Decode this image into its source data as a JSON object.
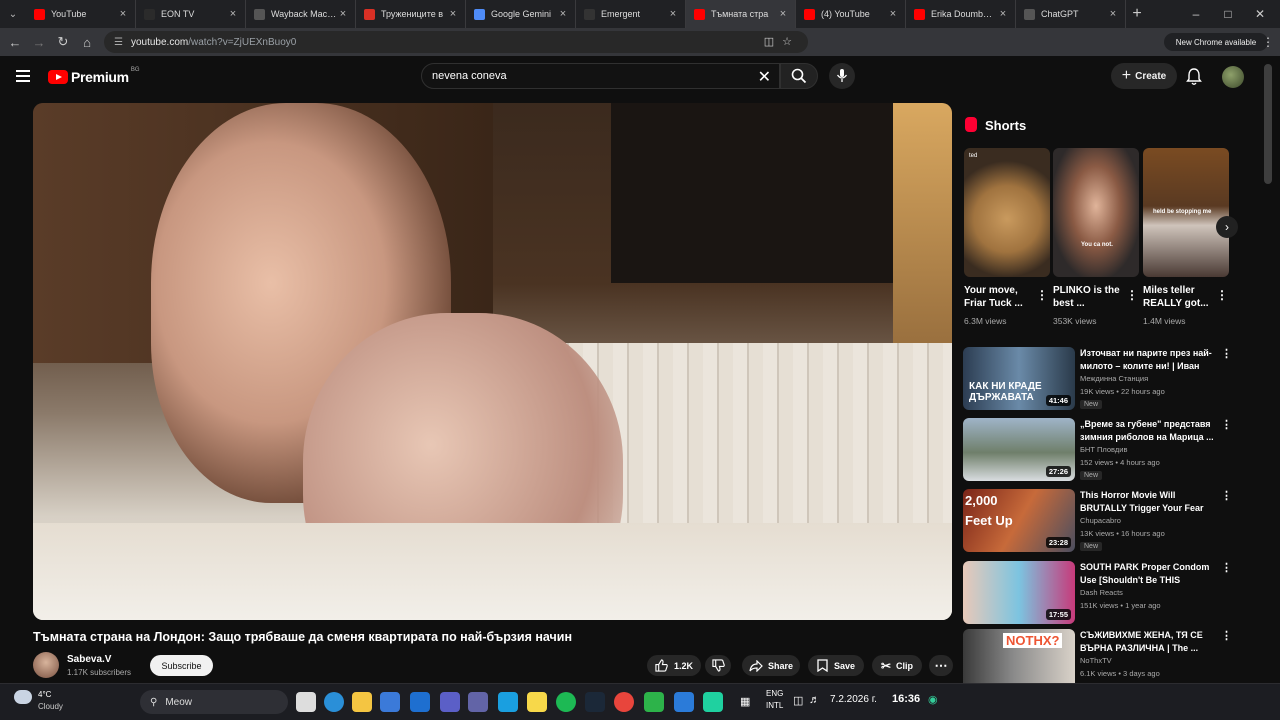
{
  "tabs": [
    {
      "title": "YouTube",
      "color": "#ff0000"
    },
    {
      "title": "EON TV",
      "color": "#2b2b2b"
    },
    {
      "title": "Wayback Machine",
      "color": "#555555"
    },
    {
      "title": "Тружениците в",
      "color": "#d93025"
    },
    {
      "title": "Google Gemini",
      "color": "#4f8cf7"
    },
    {
      "title": "Emergent",
      "color": "#333333"
    },
    {
      "title": "Тъмната стра",
      "color": "#ff0000"
    },
    {
      "title": "(4) YouTube",
      "color": "#ff0000"
    },
    {
      "title": "Erika Doumbova",
      "color": "#ff0000"
    },
    {
      "title": "ChatGPT",
      "color": "#555555"
    }
  ],
  "address": {
    "host": "youtube.com",
    "path": "/watch?v=ZjUEXnBuoy0"
  },
  "chrome_badge": "New Chrome available",
  "yt": {
    "logo": "Premium",
    "region": "BG",
    "search_value": "nevena coneva",
    "create_label": "Create"
  },
  "video": {
    "title": "Тъмната страна на Лондон: Защо трябваше да сменя квартирата по най-бързия начин",
    "channel": "Sabeva.V",
    "subscribers": "1.17K subscribers",
    "subscribe_label": "Subscribe",
    "likes": "1.2K",
    "share_label": "Share",
    "save_label": "Save",
    "clip_label": "Clip"
  },
  "shorts": {
    "heading": "Shorts",
    "items": [
      {
        "title": "Your move, Friar Tuck ...",
        "views": "6.3M views",
        "overlay": "ted"
      },
      {
        "title": "PLINKO is the best ...",
        "views": "353K views",
        "overlay": "You ca not."
      },
      {
        "title": "Miles teller REALLY got...",
        "views": "1.4M views",
        "overlay": "held be stopping me"
      }
    ]
  },
  "recommended": [
    {
      "title": "Източват ни парите през най-милото – колите ни! | Иван и...",
      "channel": "Междинна Станция",
      "meta": "19K views • 22 hours ago",
      "new": "New",
      "duration": "41:46",
      "thumb_text": "КАК НИ КРАДЕ ДЪРЖАВАТА"
    },
    {
      "title": "„Време за губене\" представя зимния риболов на Марица ...",
      "channel": "БНТ Пловдив",
      "meta": "152 views • 4 hours ago",
      "new": "New",
      "duration": "27:26",
      "thumb_text": ""
    },
    {
      "title": "This Horror Movie Will BRUTALLY Trigger Your Fear o...",
      "channel": "Chupacabro",
      "meta": "13K views • 16 hours ago",
      "new": "New",
      "duration": "23:28",
      "thumb_text": "2,000 Feet Up"
    },
    {
      "title": "SOUTH PARK Proper Condom Use [Shouldn't Be THIS Funny!]...",
      "channel": "Dash Reacts",
      "meta": "151K views • 1 year ago",
      "new": "",
      "duration": "17:55",
      "thumb_text": ""
    },
    {
      "title": "СЪЖИВИХМЕ ЖЕНА, ТЯ СЕ ВЪРНА РАЗЛИЧНА | The ...",
      "channel": "NoThxTV",
      "meta": "6.1K views • 3 days ago",
      "new": "",
      "duration": "",
      "thumb_text": "NOTHX?"
    }
  ],
  "taskbar": {
    "temp": "4°C",
    "condition": "Cloudy",
    "search": "Meow",
    "lang1": "ENG",
    "lang2": "INTL",
    "date": "7.2.2026 г.",
    "time": "16:36"
  }
}
